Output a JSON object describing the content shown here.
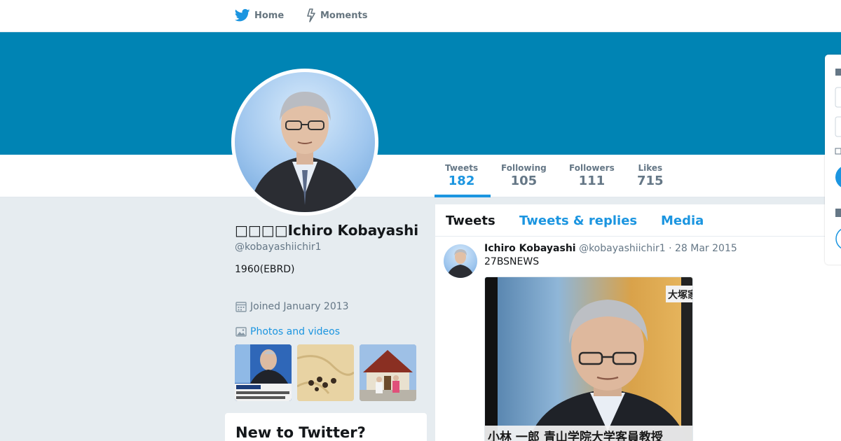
{
  "nav": {
    "home_label": "Home",
    "moments_label": "Moments"
  },
  "profile": {
    "name": "□□□□Ichiro Kobayashi",
    "handle": "@kobayashiichir1",
    "bio": "1960(EBRD)",
    "joined": "Joined January 2013",
    "photos_label": "Photos and videos"
  },
  "stats": [
    {
      "label": "Tweets",
      "value": "182"
    },
    {
      "label": "Following",
      "value": "105"
    },
    {
      "label": "Followers",
      "value": "111"
    },
    {
      "label": "Likes",
      "value": "715"
    }
  ],
  "timeline": {
    "tabs": [
      "Tweets",
      "Tweets & replies",
      "Media"
    ]
  },
  "tweet": {
    "name": "Ichiro Kobayashi",
    "handle": "@kobayashiichir1",
    "separator": " · ",
    "date": "28 Mar 2015",
    "text": "27BSNEWS",
    "media_caption": "小林 一郎  青山学院大学客員教授",
    "media_corner": "大塚家"
  },
  "new_to_twitter": {
    "title": "New to Twitter?"
  },
  "colors": {
    "header_blue": "#0084b4",
    "link_blue": "#1b95e0",
    "background": "#e6ecf0"
  }
}
